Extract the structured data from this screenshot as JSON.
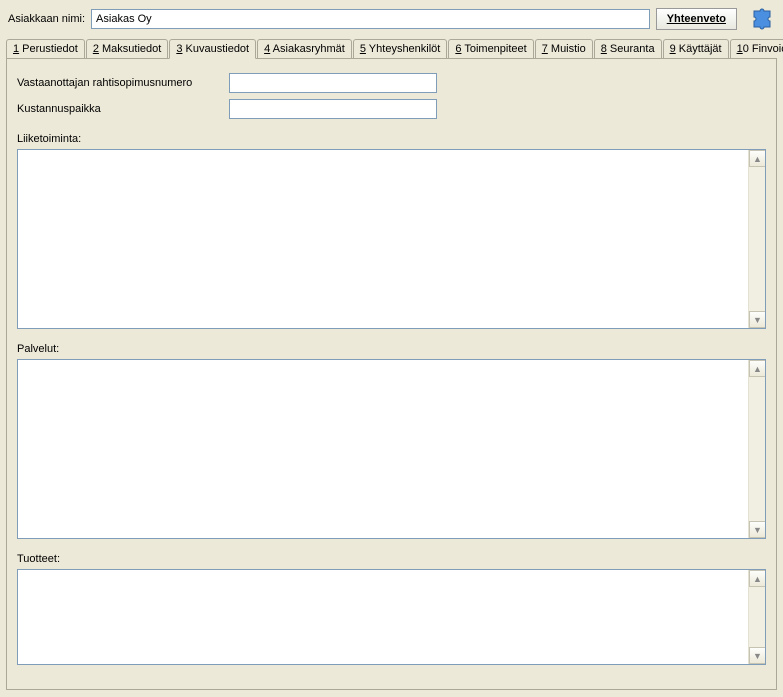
{
  "header": {
    "label": "Asiakkaan nimi:",
    "customer_name": "Asiakas Oy",
    "summary_label": "Yhteenveto"
  },
  "tabs": [
    {
      "num": "1",
      "label": "Perustiedot"
    },
    {
      "num": "2",
      "label": "Maksutiedot"
    },
    {
      "num": "3",
      "label": "Kuvaustiedot"
    },
    {
      "num": "4",
      "label": "Asiakasryhmät"
    },
    {
      "num": "5",
      "label": "Yhteyshenkilöt"
    },
    {
      "num": "6",
      "label": "Toimenpiteet"
    },
    {
      "num": "7",
      "label": "Muistio"
    },
    {
      "num": "8",
      "label": "Seuranta"
    },
    {
      "num": "9",
      "label": "Käyttäjät"
    },
    {
      "num": "10",
      "label": "Finvoice"
    }
  ],
  "active_tab_index": 2,
  "form": {
    "freight_label": "Vastaanottajan rahtisopimusnumero",
    "freight_value": "",
    "costcenter_label": "Kustannuspaikka",
    "costcenter_value": ""
  },
  "sections": {
    "business_label": "Liiketoiminta:",
    "business_value": "",
    "services_label": "Palvelut:",
    "services_value": "",
    "products_label": "Tuotteet:",
    "products_value": ""
  }
}
